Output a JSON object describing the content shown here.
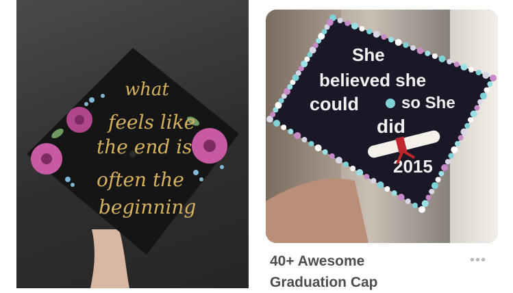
{
  "pins": [
    {
      "cap_text_lines": [
        "what",
        "feels like",
        "the end is",
        "often the",
        "beginning"
      ]
    },
    {
      "cap_text_lines": [
        "She",
        "believed she",
        "could",
        "so She",
        "did"
      ],
      "year": "2015",
      "title_lines": [
        "40+ Awesome",
        "Graduation Cap"
      ],
      "more_icon": "•••"
    }
  ],
  "colors": {
    "cap_black": "#151515",
    "gold": "#d6b25e",
    "pink": "#c75aa3",
    "gem_teal": "#7fd3d8",
    "ribbon_red": "#c0262d"
  }
}
